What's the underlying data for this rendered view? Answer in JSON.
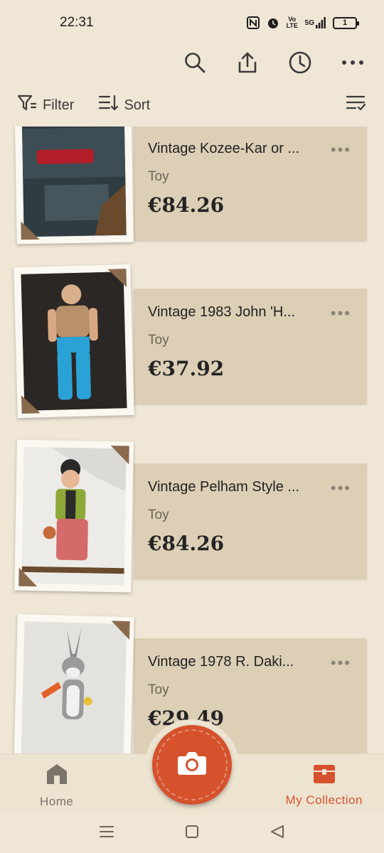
{
  "status_bar": {
    "time": "22:31",
    "battery": "1",
    "network": "5G",
    "volte": "Vo LTE",
    "icons": [
      "nfc-icon",
      "alarm-icon",
      "volte-icon",
      "signal-5g-icon",
      "battery-icon"
    ]
  },
  "top_actions": {
    "icons": [
      "search-icon",
      "share-icon",
      "history-icon",
      "more-icon"
    ]
  },
  "toolbar": {
    "filter_label": "Filter",
    "sort_label": "Sort",
    "icons": [
      "filter-icon",
      "sort-icon",
      "view-options-icon"
    ]
  },
  "items": [
    {
      "title": "Vintage Kozee-Kar or ...",
      "category": "Toy",
      "price": "€84.26"
    },
    {
      "title": "Vintage 1983 John 'H...",
      "category": "Toy",
      "price": "€37.92"
    },
    {
      "title": "Vintage Pelham Style ...",
      "category": "Toy",
      "price": "€84.26"
    },
    {
      "title": "Vintage 1978 R. Daki...",
      "category": "Toy",
      "price": "€29.49"
    }
  ],
  "more_glyph": "•••",
  "bottom_nav": {
    "home_label": "Home",
    "collection_label": "My Collection",
    "active": "collection",
    "accent": "#d5522d",
    "inactive": "#7a746a"
  },
  "camera_button": {
    "icon": "camera-icon"
  },
  "system_nav": {
    "icons": [
      "recents-icon",
      "home-square-icon",
      "back-icon"
    ]
  }
}
